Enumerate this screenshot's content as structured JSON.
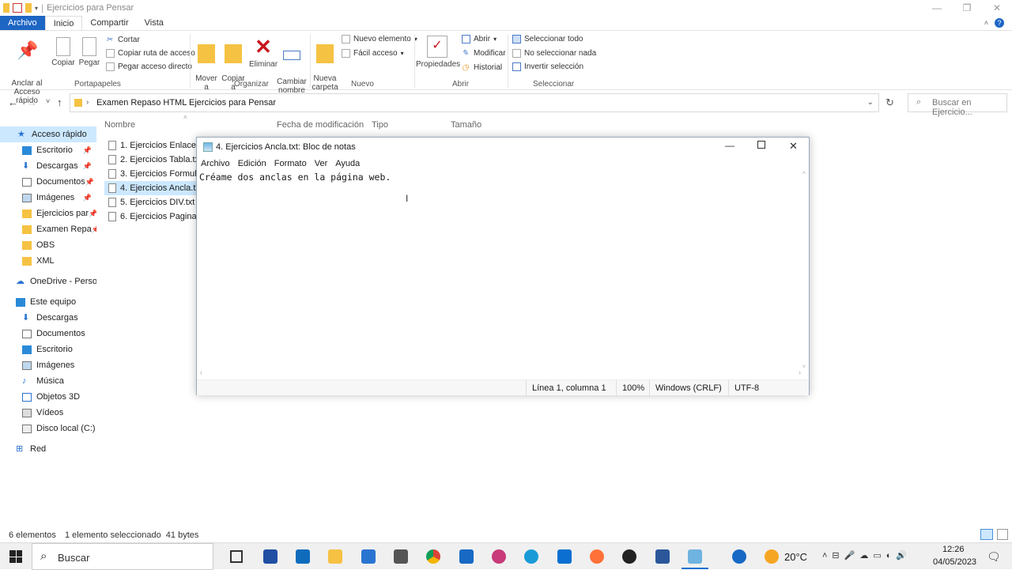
{
  "window": {
    "title": "Ejercicios para Pensar"
  },
  "ribbon_tabs": [
    "Archivo",
    "Inicio",
    "Compartir",
    "Vista"
  ],
  "ribbon": {
    "portapapeles": {
      "group": "Portapapeles",
      "pin": "Anclar al\nAcceso rápido",
      "copy": "Copiar",
      "paste": "Pegar",
      "cut": "Cortar",
      "copy_path": "Copiar ruta de acceso",
      "paste_shortcut": "Pegar acceso directo"
    },
    "organizar": {
      "group": "Organizar",
      "move": "Mover\na",
      "copy_to": "Copiar\na",
      "delete": "Eliminar",
      "rename": "Cambiar\nnombre"
    },
    "nuevo": {
      "group": "Nuevo",
      "new_folder": "Nueva\ncarpeta",
      "new_item": "Nuevo elemento",
      "easy_access": "Fácil acceso"
    },
    "abrir": {
      "group": "Abrir",
      "properties": "Propiedades",
      "open": "Abrir",
      "edit": "Modificar",
      "history": "Historial"
    },
    "seleccionar": {
      "group": "Seleccionar",
      "select_all": "Seleccionar todo",
      "select_none": "No seleccionar nada",
      "invert": "Invertir selección"
    }
  },
  "address": {
    "crumbs": [
      "Examen Repaso HTML",
      "Ejercicios para Pensar"
    ],
    "search_placeholder": "Buscar en Ejercicio..."
  },
  "nav": {
    "quick_access": "Acceso rápido",
    "pinned": [
      "Escritorio",
      "Descargas",
      "Documentos",
      "Imágenes",
      "Ejercicios par",
      "Examen Repa"
    ],
    "others": [
      "OBS",
      "XML"
    ],
    "onedrive": "OneDrive - Person",
    "this_pc": "Este equipo",
    "pc_items": [
      "Descargas",
      "Documentos",
      "Escritorio",
      "Imágenes",
      "Música",
      "Objetos 3D",
      "Vídeos",
      "Disco local (C:)"
    ],
    "network": "Red"
  },
  "columns": {
    "name": "Nombre",
    "modified": "Fecha de modificación",
    "type": "Tipo",
    "size": "Tamaño"
  },
  "files": [
    "1. Ejercicios Enlace.txt",
    "2. Ejercicios Tabla.txt",
    "3. Ejercicios Formulario",
    "4. Ejercicios Ancla.txt",
    "5. Ejercicios DIV.txt",
    "6. Ejercicios Pagina We"
  ],
  "notepad": {
    "title": "4. Ejercicios Ancla.txt: Bloc de notas",
    "menu": [
      "Archivo",
      "Edición",
      "Formato",
      "Ver",
      "Ayuda"
    ],
    "content": "Créame dos anclas en la página web.",
    "status": {
      "position": "Línea 1, columna 1",
      "zoom": "100%",
      "eol": "Windows (CRLF)",
      "encoding": "UTF-8"
    }
  },
  "statusbar": {
    "count": "6 elementos",
    "selected": "1 elemento seleccionado  41 bytes"
  },
  "taskbar": {
    "search": "Buscar",
    "temperature": "20°C",
    "time": "12:26",
    "date": "04/05/2023"
  }
}
